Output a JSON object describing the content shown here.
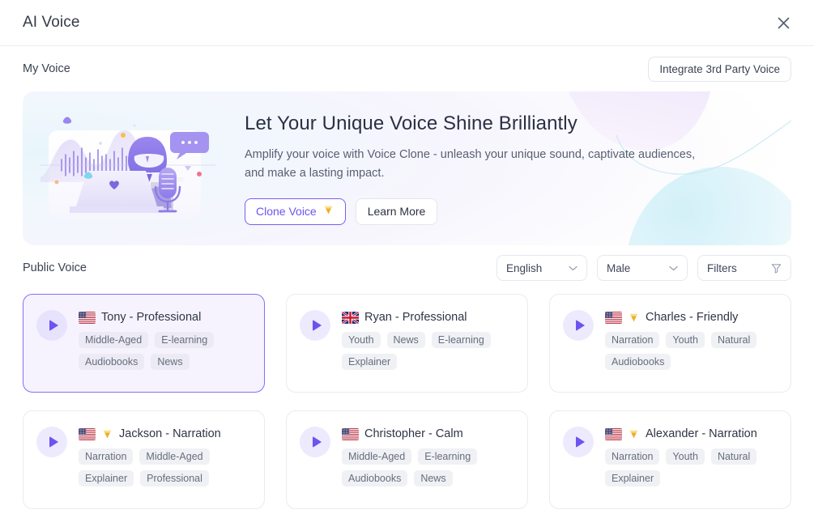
{
  "header": {
    "title": "AI Voice",
    "close_icon": "close-icon"
  },
  "my_voice": {
    "section_title": "My Voice",
    "integrate_button": "Integrate 3rd Party Voice",
    "banner": {
      "title": "Let Your Unique Voice Shine Brilliantly",
      "description": "Amplify your voice with Voice Clone - unleash your unique sound, captivate audiences, and make a lasting impact.",
      "clone_button": "Clone Voice",
      "clone_badge_icon": "diamond-icon",
      "learn_button": "Learn More",
      "illustration_icon": "voice-clone-illustration"
    }
  },
  "public_voice": {
    "section_title": "Public Voice",
    "filters": {
      "language": {
        "value": "English",
        "icon": "chevron-down-icon"
      },
      "gender": {
        "value": "Male",
        "icon": "chevron-down-icon"
      },
      "filters": {
        "value": "Filters",
        "icon": "filter-funnel-icon"
      }
    },
    "voices": [
      {
        "name": "Tony - Professional",
        "flag": "us",
        "premium": false,
        "selected": true,
        "tags": [
          "Middle-Aged",
          "E-learning",
          "Audiobooks",
          "News"
        ]
      },
      {
        "name": "Ryan - Professional",
        "flag": "uk",
        "premium": false,
        "selected": false,
        "tags": [
          "Youth",
          "News",
          "E-learning",
          "Explainer"
        ]
      },
      {
        "name": "Charles - Friendly",
        "flag": "us",
        "premium": true,
        "selected": false,
        "tags": [
          "Narration",
          "Youth",
          "Natural",
          "Audiobooks"
        ]
      },
      {
        "name": "Jackson - Narration",
        "flag": "us",
        "premium": true,
        "selected": false,
        "tags": [
          "Narration",
          "Middle-Aged",
          "Explainer",
          "Professional"
        ]
      },
      {
        "name": "Christopher - Calm",
        "flag": "us",
        "premium": false,
        "selected": false,
        "tags": [
          "Middle-Aged",
          "E-learning",
          "Audiobooks",
          "News"
        ]
      },
      {
        "name": "Alexander - Narration",
        "flag": "us",
        "premium": true,
        "selected": false,
        "tags": [
          "Narration",
          "Youth",
          "Natural",
          "Explainer"
        ]
      }
    ]
  },
  "colors": {
    "accent": "#6c54f0",
    "accent_border": "#8a6df5",
    "selected_bg": "#f6f3ff",
    "tag_bg": "#f0f1f4",
    "text": "#2d3142",
    "muted": "#666d7e",
    "border": "#e9ebf1"
  }
}
